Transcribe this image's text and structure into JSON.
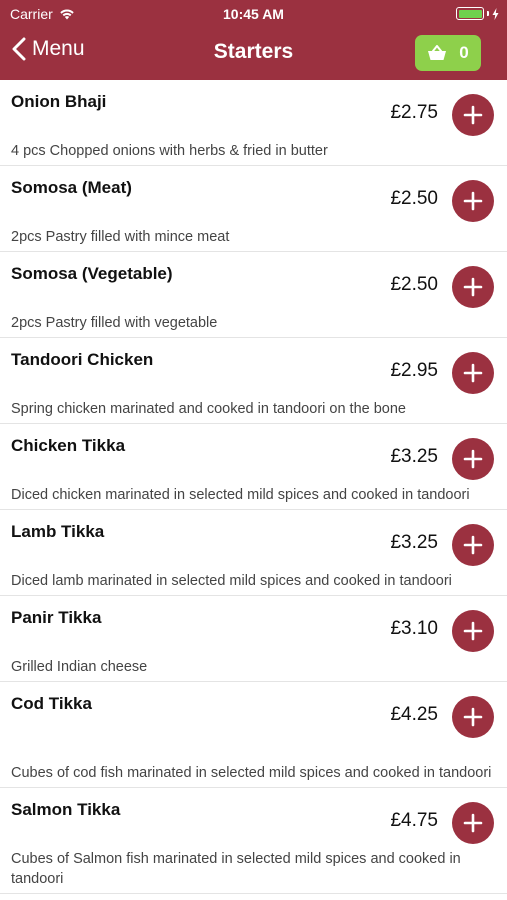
{
  "status_bar": {
    "carrier": "Carrier",
    "time": "10:45 AM"
  },
  "nav": {
    "back_label": "Menu",
    "title": "Starters",
    "basket_count": "0"
  },
  "items": [
    {
      "name": "Onion Bhaji",
      "price": "£2.75",
      "description": "4 pcs Chopped onions with herbs & fried in butter"
    },
    {
      "name": "Somosa (Meat)",
      "price": "£2.50",
      "description": "2pcs Pastry filled with mince meat"
    },
    {
      "name": "Somosa (Vegetable)",
      "price": "£2.50",
      "description": "2pcs Pastry filled with vegetable"
    },
    {
      "name": "Tandoori Chicken",
      "price": "£2.95",
      "description": "Spring chicken marinated and cooked in tandoori on the bone"
    },
    {
      "name": "Chicken Tikka",
      "price": "£3.25",
      "description": "Diced chicken marinated in selected mild spices and cooked in tandoori"
    },
    {
      "name": "Lamb Tikka",
      "price": "£3.25",
      "description": "Diced lamb marinated in selected mild spices and cooked in tandoori"
    },
    {
      "name": "Panir Tikka",
      "price": "£3.10",
      "description": "Grilled Indian cheese"
    },
    {
      "name": "Cod Tikka",
      "price": "£4.25",
      "description": "Cubes of cod fish marinated in selected mild spices and cooked in tandoori"
    },
    {
      "name": "Salmon Tikka",
      "price": "£4.75",
      "description": "Cubes of Salmon fish marinated in selected mild spices and cooked in tandoori"
    }
  ],
  "colors": {
    "brand": "#9b3140",
    "basket": "#8ed04b"
  }
}
